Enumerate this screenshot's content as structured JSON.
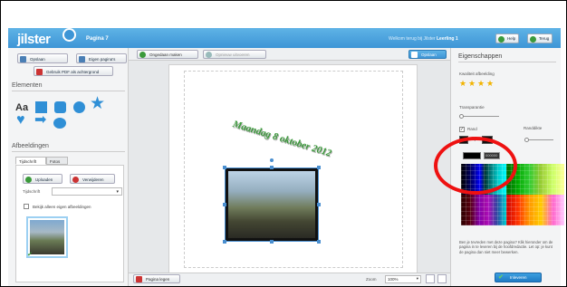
{
  "header": {
    "logo": "jilster",
    "page_title": "Pagina 7",
    "welcome_prefix": "Welkom terug bij Jilster",
    "welcome_user": "Leerling 1",
    "help_label": "Help",
    "back_label": "Terug"
  },
  "left_panel": {
    "save_label": "Opslaan",
    "own_pages_label": "Eigen pagina's",
    "pdf_bg_label": "Gebruik PDF als achtergrond",
    "elements_title": "Elementen",
    "elements_text_icon": "Aa",
    "images_title": "Afbeeldingen",
    "tab_all": "Tijdschrift",
    "tab_photos": "Fotos",
    "upload_label": "Uploaden",
    "delete_label": "Verwijderen",
    "folder_label": "Tijdschrift",
    "only_own_label": "Bekijk alleen eigen afbeeldingen"
  },
  "toolbar": {
    "undo_label": "Ongedaan maken",
    "redo_label": "Opnieuw uitvoeren",
    "save_label": "Opslaan"
  },
  "canvas": {
    "date_text": "Maandag 8 oktober 2012"
  },
  "bottom": {
    "delete_page_label": "Pagina legen",
    "zoom_label": "Zoom",
    "zoom_value": "100%"
  },
  "right_panel": {
    "title": "Eigenschappen",
    "quality_label": "Kwaliteit afbeelding",
    "quality_stars": 4,
    "transparency_label": "Transparantie",
    "border_label": "Rand",
    "border_width_label": "Randdikte",
    "hex_value": "000000",
    "help_text": "Ben je tevreden met deze pagina? Klik hieronder om de pagina in te leveren bij de hoofdredactie. Let op: je kunt de pagina dan niet meer bewerken.",
    "submit_label": "Inleveren"
  },
  "colors": {
    "header": "#3d95d6",
    "accent_green": "#3a9a3a",
    "highlight": "#e11111"
  }
}
